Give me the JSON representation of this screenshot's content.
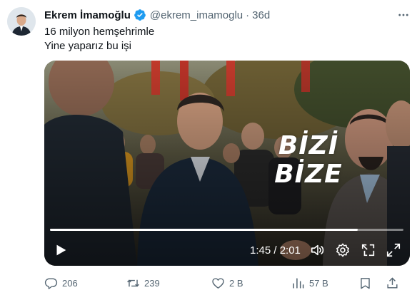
{
  "author": {
    "name": "Ekrem İmamoğlu",
    "handle": "@ekrem_imamoglu",
    "separator": "·",
    "time": "36d"
  },
  "tweet": {
    "lines": [
      "16 milyon hemşehrimle",
      "Yine yaparız bu işi"
    ]
  },
  "video": {
    "overlay_lines": [
      "BİZİ",
      "BİZE"
    ],
    "time_readout": "1:45 / 2:01",
    "progress": 0.87,
    "icons": [
      "play-icon",
      "volume-icon",
      "settings-icon",
      "pip-icon",
      "fullscreen-icon"
    ]
  },
  "actions": {
    "replies": "206",
    "reposts": "239",
    "likes": "2 B",
    "views": "57 B"
  },
  "colors": {
    "text": "#0f1419",
    "muted": "#536471",
    "verified": "#1d9bf0",
    "repost": "#00ba7c"
  }
}
